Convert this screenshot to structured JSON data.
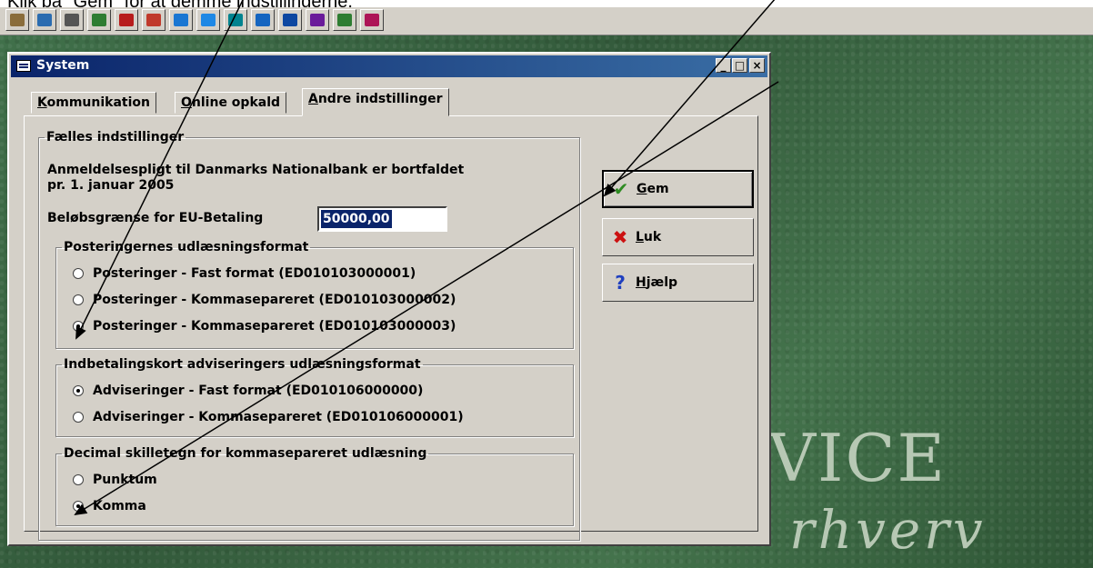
{
  "caption": "Klik på \"Gem\" for at gemme indstillingerne.",
  "toolbar": {
    "icons": [
      {
        "name": "tools-icon",
        "color": "#8a6d3b"
      },
      {
        "name": "keyboard-icon",
        "color": "#2b6cb0"
      },
      {
        "name": "printer-icon",
        "color": "#555555"
      },
      {
        "name": "bank-icon",
        "color": "#2e7d32"
      },
      {
        "name": "book-icon",
        "color": "#b71c1c"
      },
      {
        "name": "chart-icon",
        "color": "#c0392b"
      },
      {
        "name": "folder-icon",
        "color": "#1976d2"
      },
      {
        "name": "globe-icon",
        "color": "#1e88e5"
      },
      {
        "name": "monitor-icon",
        "color": "#00838f"
      },
      {
        "name": "numbers-icon",
        "color": "#1565c0"
      },
      {
        "name": "world-icon",
        "color": "#0d47a1"
      },
      {
        "name": "transfer-icon",
        "color": "#6a1b9a"
      },
      {
        "name": "bird-icon",
        "color": "#2e7d32"
      },
      {
        "name": "calendar-icon",
        "color": "#ad1457"
      }
    ]
  },
  "window": {
    "title": "System",
    "controls": {
      "minimize": "_",
      "maximize": "□",
      "close": "×"
    }
  },
  "tabs": [
    {
      "key": "K",
      "rest": "ommunikation"
    },
    {
      "key": "O",
      "rest": "nline opkald"
    },
    {
      "key": "A",
      "rest": "ndre indstillinger"
    }
  ],
  "common": {
    "legend": "Fælles indstillinger",
    "notice_line1": "Anmeldelsespligt til Danmarks Nationalbank er bortfaldet",
    "notice_line2": "pr. 1. januar 2005",
    "limit_label": "Beløbsgrænse for EU-Betaling",
    "limit_value": "50000,00"
  },
  "groups": {
    "posting": {
      "legend": "Posteringernes udlæsningsformat",
      "options": [
        {
          "label": "Posteringer - Fast format (ED010103000001)",
          "checked": false
        },
        {
          "label": "Posteringer - Kommasepareret (ED010103000002)",
          "checked": false
        },
        {
          "label": "Posteringer - Kommasepareret (ED010103000003)",
          "checked": true
        }
      ]
    },
    "advice": {
      "legend": "Indbetalingskort adviseringers udlæsningsformat",
      "options": [
        {
          "label": "Adviseringer - Fast format (ED010106000000)",
          "checked": true
        },
        {
          "label": "Adviseringer - Kommasepareret (ED010106000001)",
          "checked": false
        }
      ]
    },
    "decimal": {
      "legend": "Decimal skilletegn for kommasepareret udlæsning",
      "options": [
        {
          "label": "Punktum",
          "checked": false
        },
        {
          "label": "Komma",
          "checked": true
        }
      ]
    }
  },
  "buttons": {
    "save": {
      "key": "G",
      "rest": "em",
      "icon": "checkmark-icon",
      "color": "#2e8b22"
    },
    "close": {
      "key": "L",
      "rest": "uk",
      "icon": "x-icon",
      "color": "#cc1111"
    },
    "help": {
      "key": "H",
      "rest": "jælp",
      "icon": "question-icon",
      "color": "#1f3fbf"
    }
  },
  "background": {
    "watermark_line1": "VICE",
    "watermark_line2": "rhverv"
  }
}
